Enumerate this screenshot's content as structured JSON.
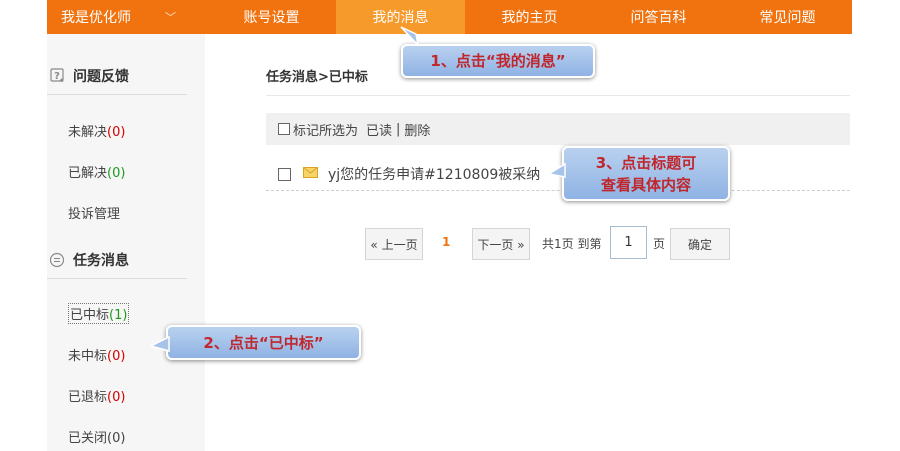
{
  "nav": {
    "brand": "我是优化师",
    "items": [
      "账号设置",
      "我的消息",
      "我的主页",
      "问答百科",
      "常见问题"
    ],
    "active_index": 1
  },
  "sidebar": {
    "feedback": {
      "title": "问题反馈",
      "items": [
        {
          "label": "未解决",
          "count": "(0)"
        },
        {
          "label": "已解决",
          "count": "(0)"
        },
        {
          "label": "投诉管理"
        }
      ]
    },
    "task": {
      "title": "任务消息",
      "items": [
        {
          "label": "已中标",
          "count": "(1)"
        },
        {
          "label": "未中标",
          "count": "(0)"
        },
        {
          "label": "已退标",
          "count": "(0)"
        },
        {
          "label": "已关闭",
          "count": "(0)"
        }
      ]
    }
  },
  "main": {
    "breadcrumb": "任务消息>已中标",
    "toolbar": {
      "select_all_label": "标记所选为",
      "read_action": "已读",
      "separator": "|",
      "delete_action": "删除"
    },
    "messages": [
      {
        "title": "yj您的任务申请#1210809被采纳"
      }
    ]
  },
  "pagination": {
    "prev": "« 上一页",
    "current": "1",
    "next": "下一页 »",
    "summary": "共1页 到第",
    "page_value": "1",
    "page_suffix": "页",
    "confirm": "确定"
  },
  "callouts": {
    "step1": "1、点击“我的消息”",
    "step2": "2、点击“已中标”",
    "step3_line1": "3、点击标题可",
    "step3_line2": "查看具体内容"
  },
  "colors": {
    "nav_bg": "#f0730f",
    "nav_active": "#f79a2c",
    "count_red": "#d40000",
    "count_green": "#1d9a1d",
    "callout_text": "#c0272d"
  }
}
